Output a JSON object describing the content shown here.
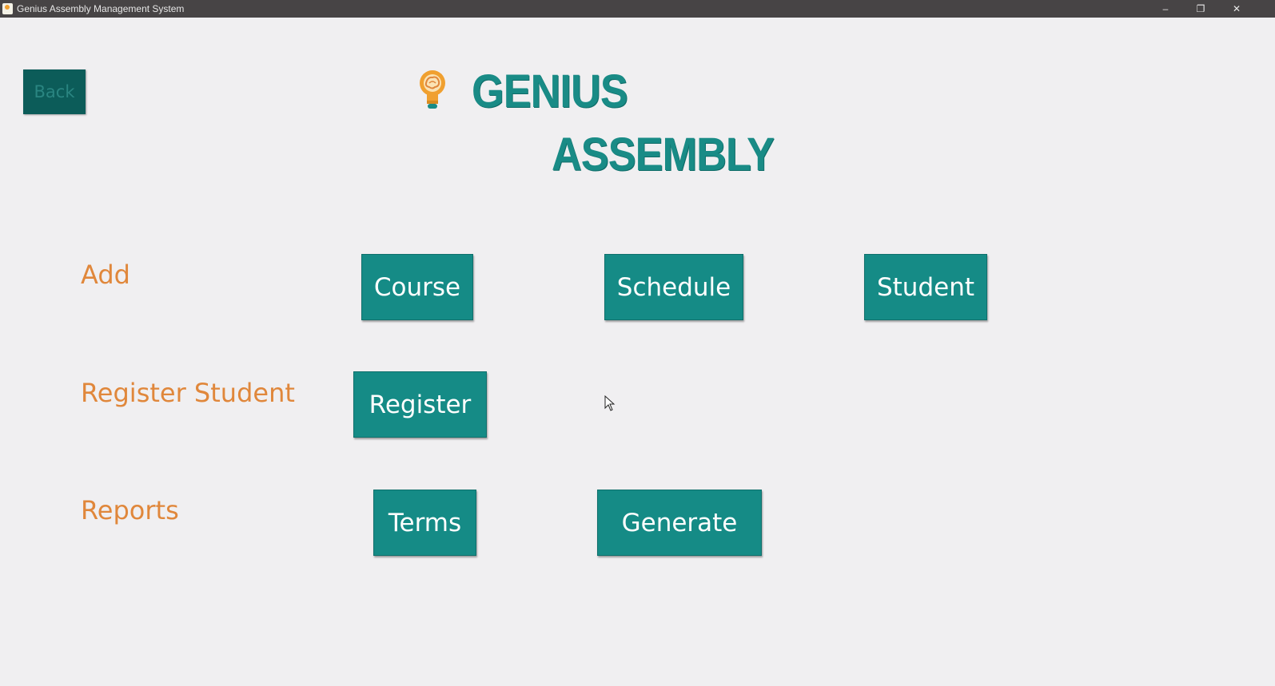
{
  "window": {
    "title": "Genius Assembly Management System",
    "controls": {
      "minimize": "–",
      "maximize": "❐",
      "close": "✕"
    }
  },
  "header": {
    "back_label": "Back",
    "logo_icon": "lightbulb-brain-icon",
    "logo_line1": "GENIUS",
    "logo_line2": "ASSEMBLY"
  },
  "sections": {
    "add": {
      "label": "Add",
      "buttons": [
        "Course",
        "Schedule",
        "Student"
      ]
    },
    "register": {
      "label": "Register Student",
      "buttons": [
        "Register"
      ]
    },
    "reports": {
      "label": "Reports",
      "buttons": [
        "Terms",
        "Generate"
      ]
    }
  },
  "colors": {
    "background": "#f0eff1",
    "titlebar": "#474445",
    "accent_teal": "#158b86",
    "back_button": "#0c5c59",
    "label_orange": "#e0873b",
    "logo_bulb": "#f0a030"
  }
}
